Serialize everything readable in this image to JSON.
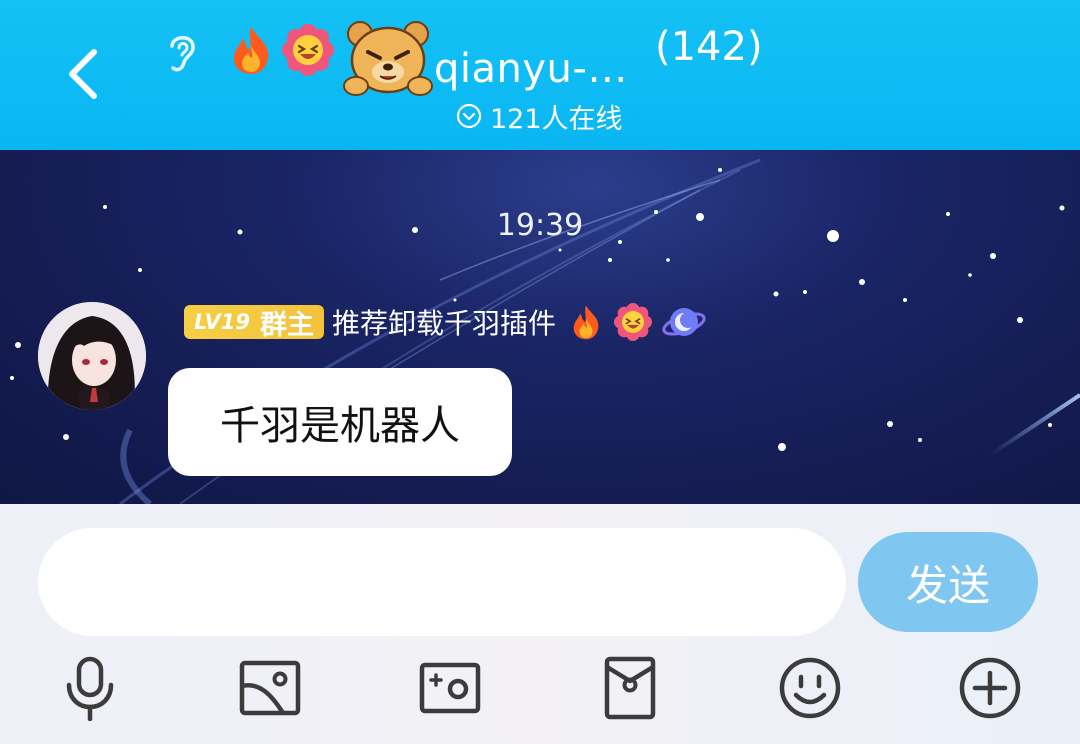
{
  "header": {
    "group_name": "qianyu-…",
    "member_count": "(142)",
    "online_text": "121人在线",
    "icons": [
      "back-icon",
      "ear-icon",
      "fire-emoji",
      "laughing-flower-emoji",
      "bear-avatar"
    ]
  },
  "chat": {
    "timestamp": "19:39",
    "messages": [
      {
        "level": "LV19",
        "role": "群主",
        "sender_title": "推荐卸载千羽插件",
        "title_icons": [
          "fire-emoji",
          "laughing-flower-emoji",
          "planet-icon"
        ],
        "text": "千羽是机器人"
      }
    ]
  },
  "input": {
    "placeholder": "",
    "value": "",
    "send_label": "发送"
  },
  "toolbar": {
    "items": [
      "microphone-icon",
      "image-icon",
      "camera-icon",
      "red-packet-icon",
      "emoji-icon",
      "plus-icon"
    ]
  },
  "colors": {
    "header": "#0ab6f2",
    "send_button": "#7fc7f0",
    "level_badge": "#f3c23a",
    "chat_bg": "#141c52"
  }
}
